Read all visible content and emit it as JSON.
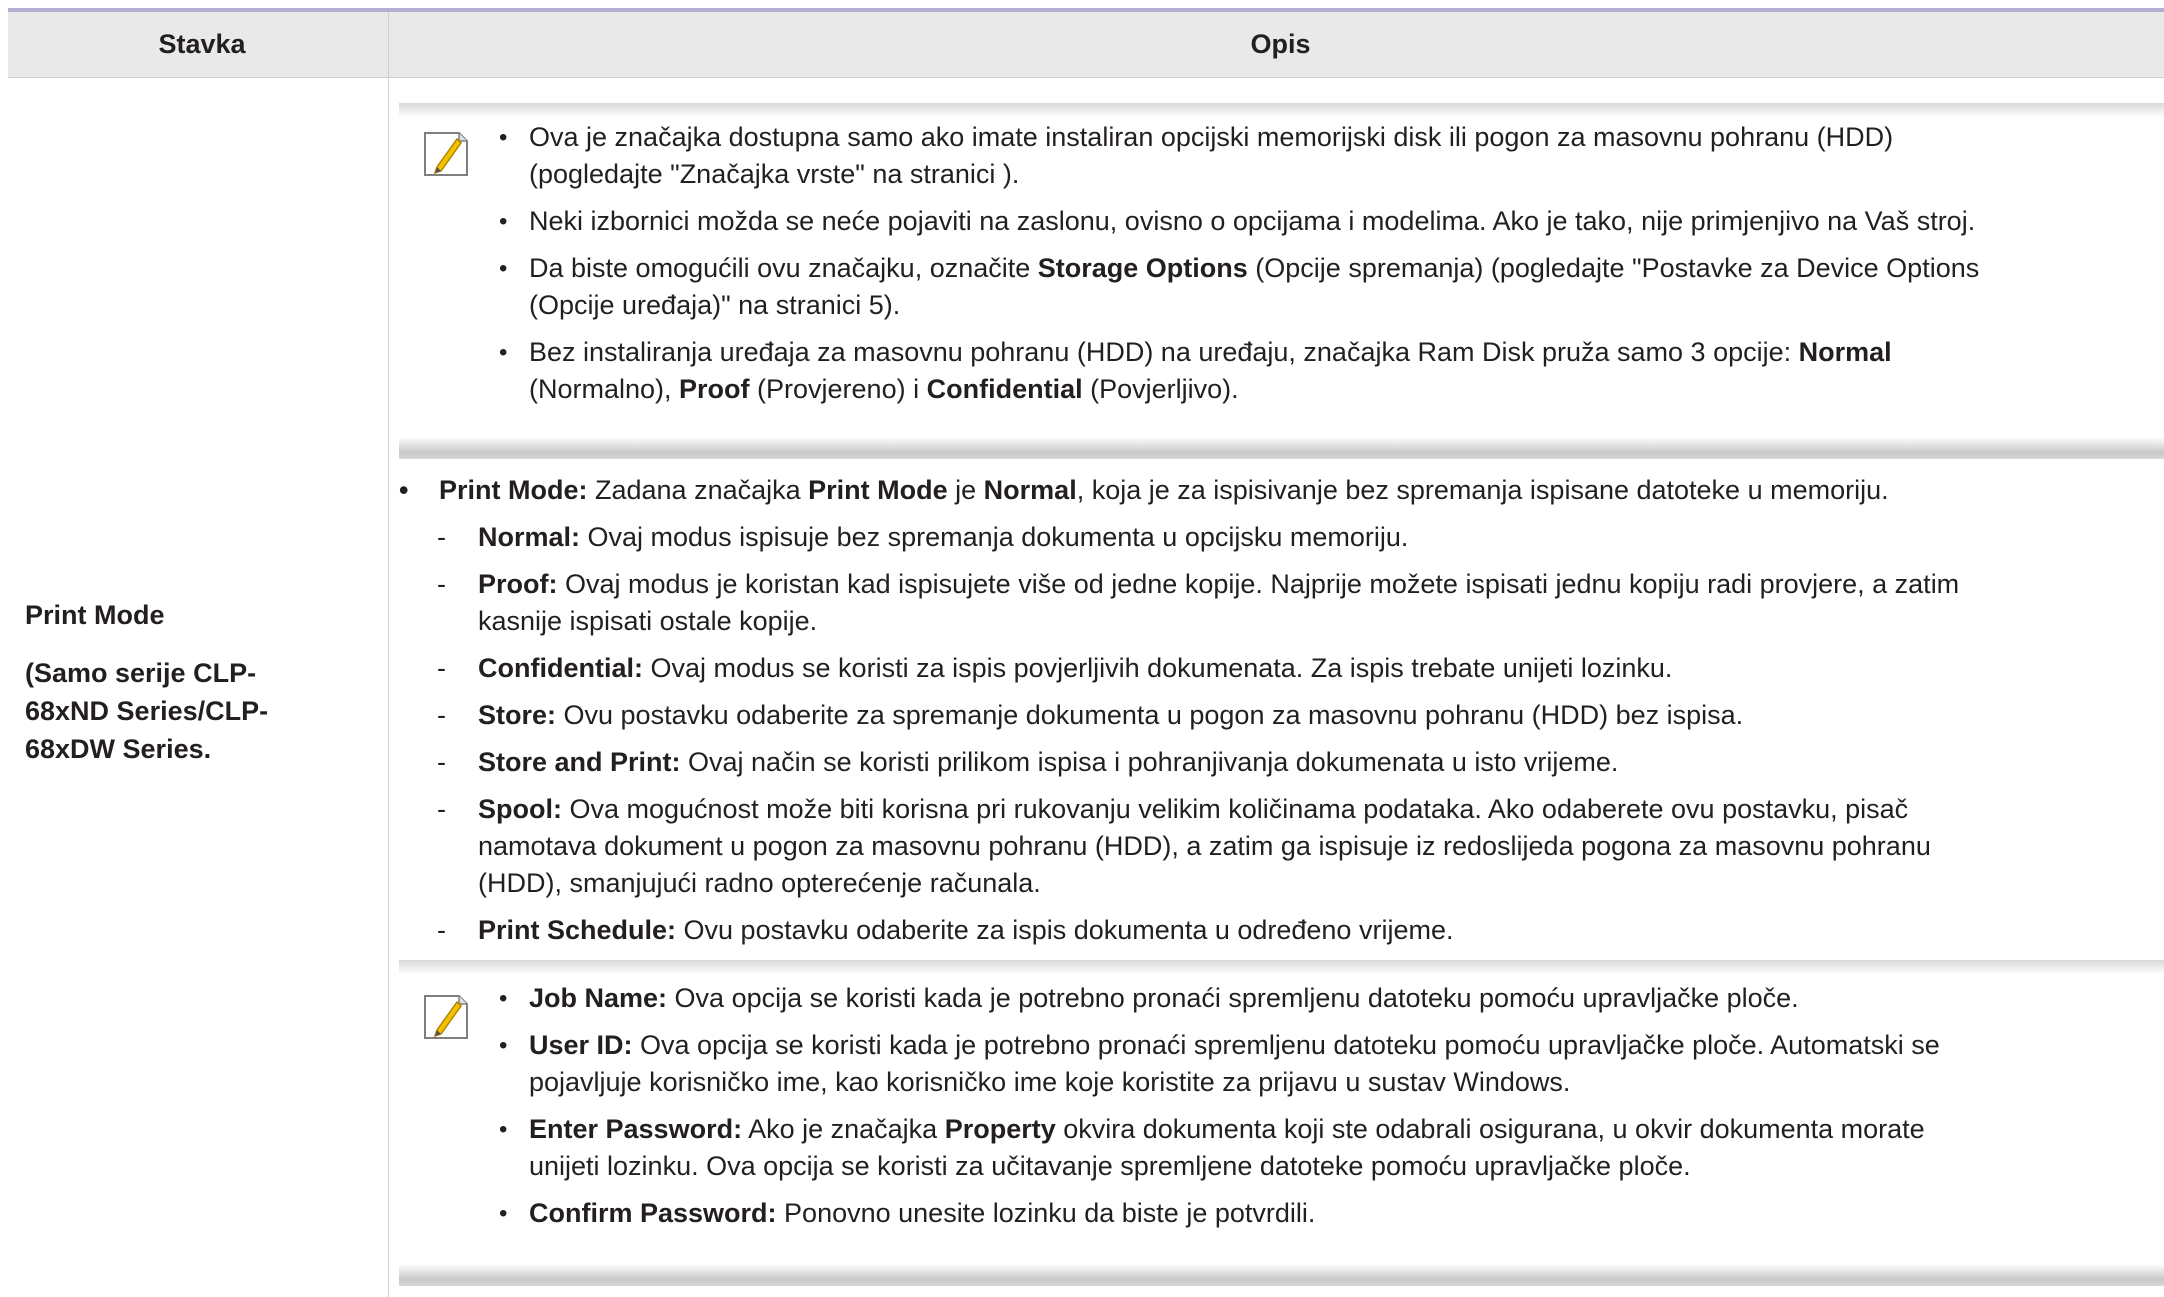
{
  "table": {
    "headers": [
      "Stavka",
      "Opis"
    ]
  },
  "row": {
    "left": {
      "title": "Print Mode",
      "subtitle_lines": [
        "(Samo serije CLP-",
        "68xND Series/CLP-",
        "68xDW Series."
      ]
    }
  },
  "note1": {
    "icon": "note-pencil-icon",
    "items": [
      [
        "Ova je značajka dostupna samo ako imate instaliran opcijski memorijski disk ili pogon za masovnu pohranu (HDD)",
        "(pogledajte \"Značajka vrste\" na stranici )."
      ],
      [
        "Neki izbornici možda se neće pojaviti na zaslonu, ovisno o opcijama i modelima. Ako je tako, nije primjenjivo na Vaš stroj."
      ],
      [
        "Da biste omogućili ovu značajku, označite ",
        "Storage Options",
        " (Opcije spremanja) (pogledajte \"Postavke za Device Options",
        "(Opcije uređaja)\" na stranici 5)."
      ],
      [
        "Bez instaliranja uređaja za masovnu pohranu (HDD) na uređaju, značajka Ram Disk pruža samo 3 opcije: ",
        "Normal",
        "(Normalno), ",
        "Proof",
        " (Provjereno) i ",
        "Confidential",
        " (Povjerljivo)."
      ]
    ]
  },
  "main": {
    "head_label": "Print Mode:",
    "head_text_1": " Zadana značajka ",
    "head_bold_2": "Print Mode",
    "head_text_3": " je ",
    "head_bold_4": "Normal",
    "head_text_5": ", koja je za ispisivanje bez spremanja ispisane datoteke u memoriju.",
    "items": [
      {
        "label": "Normal:",
        "lines": [
          " Ovaj modus ispisuje bez spremanja dokumenta u opcijsku memoriju."
        ]
      },
      {
        "label": "Proof:",
        "lines": [
          " Ovaj modus je koristan kad ispisujete više od jedne kopije. Najprije možete ispisati jednu kopiju radi provjere, a zatim",
          "kasnije ispisati ostale kopije."
        ]
      },
      {
        "label": "Confidential:",
        "lines": [
          " Ovaj modus se koristi za ispis povjerljivih dokumenata. Za ispis trebate unijeti lozinku."
        ]
      },
      {
        "label": "Store:",
        "lines": [
          " Ovu postavku odaberite za spremanje dokumenta u pogon za masovnu pohranu (HDD) bez ispisa."
        ]
      },
      {
        "label": "Store and Print:",
        "lines": [
          " Ovaj način se koristi prilikom ispisa i pohranjivanja dokumenata u isto vrijeme."
        ]
      },
      {
        "label": "Spool:",
        "lines": [
          " Ova mogućnost može biti korisna pri rukovanju velikim količinama podataka. Ako odaberete ovu postavku, pisač",
          "namotava dokument u pogon za masovnu pohranu (HDD), a zatim ga ispisuje iz redoslijeda pogona za masovnu pohranu",
          "(HDD), smanjujući radno opterećenje računala."
        ]
      },
      {
        "label": "Print Schedule:",
        "lines": [
          " Ovu postavku odaberite za ispis dokumenta u određeno vrijeme."
        ]
      }
    ]
  },
  "note2": {
    "icon": "note-pencil-icon",
    "items": [
      {
        "label": "Job Name:",
        "lines": [
          " Ova opcija se koristi kada je potrebno pronaći spremljenu datoteku pomoću upravljačke ploče."
        ]
      },
      {
        "label": "User ID:",
        "lines": [
          " Ova opcija se koristi kada je potrebno pronaći spremljenu datoteku pomoću upravljačke ploče. Automatski se",
          "pojavljuje korisničko ime, kao korisničko ime koje koristite za prijavu u sustav Windows."
        ]
      },
      {
        "label": "Enter Password:",
        "lines": [
          " Ako je značajka ",
          "Property",
          " okvira dokumenta koji ste odabrali osigurana, u okvir dokumenta morate",
          "unijeti lozinku. Ova opcija se koristi za učitavanje spremljene datoteke pomoću upravljačke ploče."
        ]
      },
      {
        "label": "Confirm Password:",
        "lines": [
          " Ponovno unesite lozinku da biste je potvrdili."
        ]
      }
    ]
  }
}
